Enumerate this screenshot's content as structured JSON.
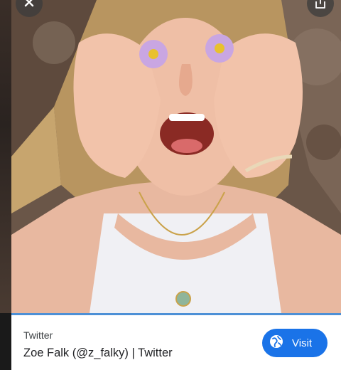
{
  "result": {
    "source": "Twitter",
    "title": "Zoe Falk (@z_falky) | Twitter",
    "visit_label": "Visit"
  },
  "icons": {
    "close": "close-icon",
    "share": "share-icon",
    "globe": "globe-icon"
  },
  "colors": {
    "accent": "#1a73e8",
    "card_border": "#4d90d6"
  }
}
